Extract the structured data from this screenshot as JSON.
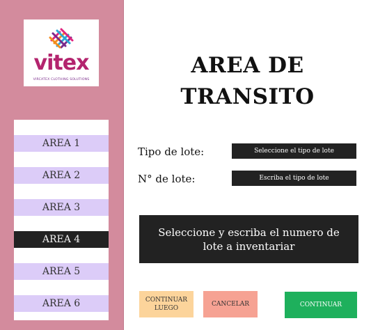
{
  "logo": {
    "wordmark": "vitex",
    "tagline": "VIRCATEX CLOTHING SOLUTIONS"
  },
  "sidebar": {
    "items": [
      {
        "label": "AREA 1",
        "active": false
      },
      {
        "label": "AREA 2",
        "active": false
      },
      {
        "label": "AREA 3",
        "active": false
      },
      {
        "label": "AREA 4",
        "active": true
      },
      {
        "label": "AREA 5",
        "active": false
      },
      {
        "label": "AREA 6",
        "active": false
      }
    ]
  },
  "main": {
    "title_line1": "AREA DE",
    "title_line2": "TRANSITO",
    "tipo_lote_label": "Tipo de lote:",
    "tipo_lote_value": "Seleccione el tipo de lote",
    "num_lote_label": "N° de lote:",
    "num_lote_value": "Escriba el tipo de lote",
    "notice": "Seleccione y escriba el numero de lote a inventariar"
  },
  "buttons": {
    "later": "CONTINUAR LUEGO",
    "cancel": "CANCELAR",
    "continue": "CONTINUAR"
  },
  "colors": {
    "sidebar_bg": "#d38b9d",
    "menu_item": "#dcccf8",
    "menu_active": "#222222",
    "later_btn": "#fcd49b",
    "cancel_btn": "#f6a293",
    "continue_btn": "#1eb05c",
    "brand": "#b3246e"
  }
}
